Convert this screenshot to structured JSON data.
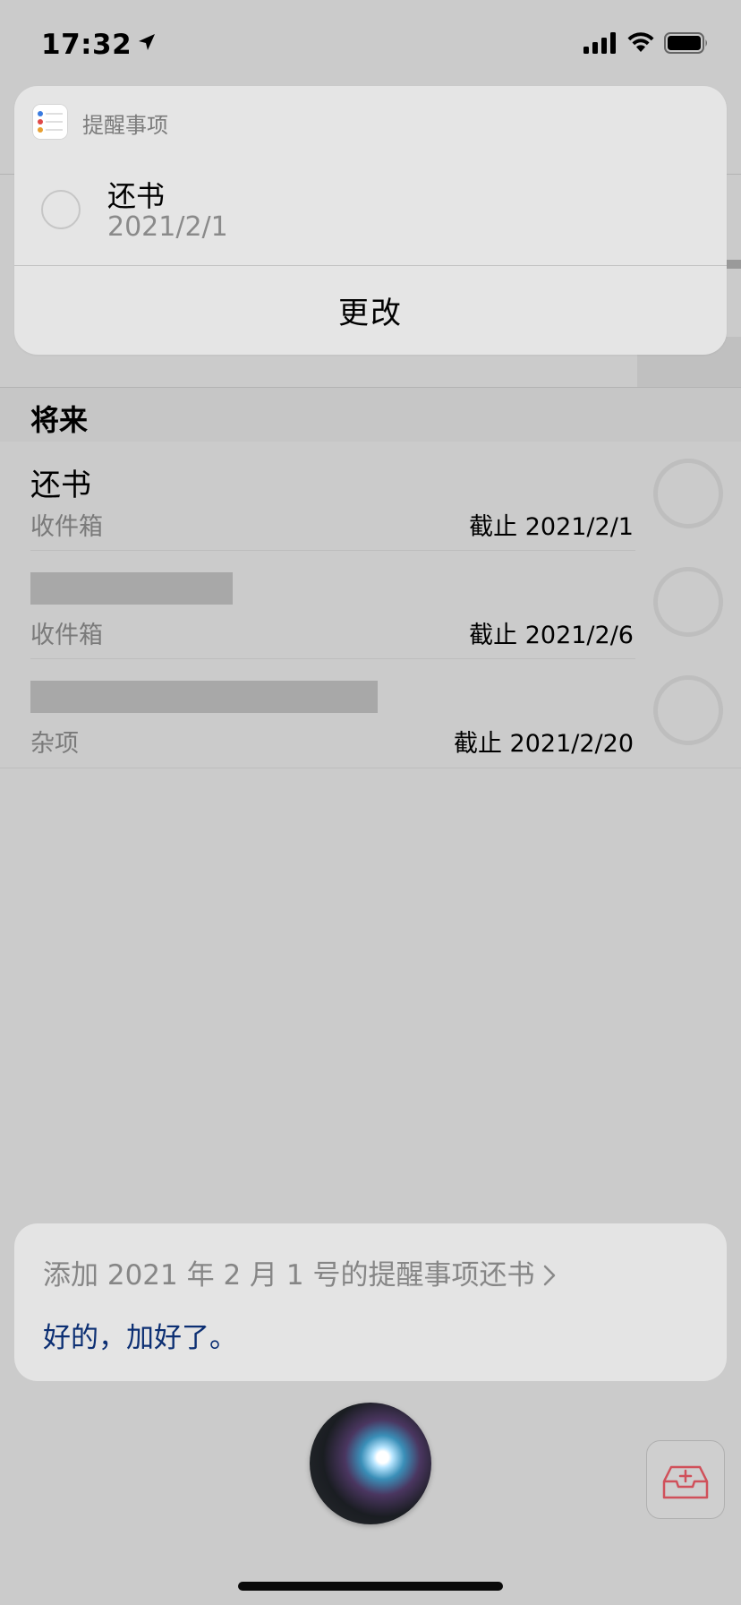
{
  "status_bar": {
    "time": "17:32"
  },
  "siri_card": {
    "app_name": "提醒事项",
    "reminder_title": "还书",
    "reminder_date": "2021/2/1",
    "change_label": "更改"
  },
  "list": {
    "section_title": "将来",
    "rows": [
      {
        "title": "还书",
        "list_name": "收件箱",
        "due": "截止 2021/2/1"
      },
      {
        "title": "",
        "list_name": "收件箱",
        "due": "截止 2021/2/6"
      },
      {
        "title": "",
        "list_name": "杂项",
        "due": "截止 2021/2/20"
      }
    ]
  },
  "siri_response": {
    "query": "添加 2021 年 2 月 1 号的提醒事项还书",
    "reply": "好的，加好了。"
  },
  "colors": {
    "siri_reply": "#0c2f73",
    "inbox_icon": "#d0505a"
  },
  "icons": [
    "location-arrow-icon",
    "cellular-signal-icon",
    "wifi-icon",
    "battery-icon",
    "reminders-app-icon",
    "chevron-right-icon",
    "siri-orb-icon",
    "inbox-add-icon"
  ]
}
